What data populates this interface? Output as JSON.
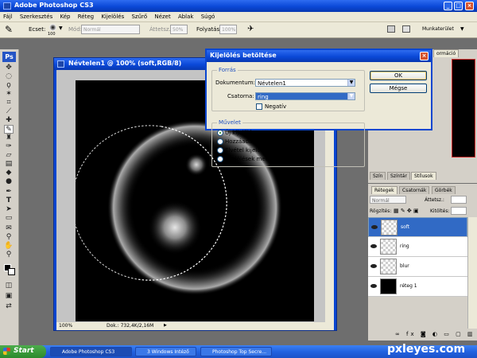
{
  "app": {
    "title": "Adobe Photoshop CS3"
  },
  "menu": [
    "Fájl",
    "Szerkesztés",
    "Kép",
    "Réteg",
    "Kijelölés",
    "Szűrő",
    "Nézet",
    "Ablak",
    "Súgó"
  ],
  "options": {
    "brush_label": "Ecset:",
    "brush_size": "100",
    "mode_label": "Mód:",
    "mode_value": "Normál",
    "opacity_label": "Áttetsz.:",
    "opacity_value": "50%",
    "flow_label": "Folyatás:",
    "flow_value": "100%",
    "workspace_label": "Munkaterület"
  },
  "document": {
    "title": "Névtelen1 @ 100% (soft,RGB/8)",
    "zoom": "100%",
    "doc_info": "Dok.: 732,4K/2,16M"
  },
  "dialog": {
    "title": "Kijelölés betöltése",
    "source_group": "Forrás",
    "document_label": "Dokumentum:",
    "document_value": "Névtelen1",
    "channel_label": "Csatorna:",
    "channel_value": "ring",
    "invert_label": "Negatív",
    "operation_group": "Művelet",
    "operations": [
      {
        "label": "Új kijelölés",
        "selected": true
      },
      {
        "label": "Hozzáadás kijelöléshez",
        "selected": false
      },
      {
        "label": "Elvétel kijelölésből",
        "selected": false
      },
      {
        "label": "Kijelölések metszete",
        "selected": false
      }
    ],
    "ok_label": "OK",
    "cancel_label": "Mégse"
  },
  "nav_panel": {
    "tab_fragment": "ormáció"
  },
  "history_tabs": [
    "Szín",
    "Színtár",
    "Stílusok"
  ],
  "layers_panel": {
    "tabs": [
      "Rétegek",
      "Csatornák",
      "Görbék"
    ],
    "blend_mode": "Normál",
    "opacity_label": "Áttetsz.:",
    "lock_label": "Rögzítés:",
    "fill_label": "Kitöltés:",
    "layers": [
      {
        "name": "soft",
        "selected": true
      },
      {
        "name": "ring",
        "selected": false
      },
      {
        "name": "blur",
        "selected": false
      },
      {
        "name": "réteg 1",
        "selected": false
      }
    ]
  },
  "taskbar": {
    "start_label": "Start",
    "tasks": [
      "Adobe Photoshop CS3",
      "3 Windows Intéző",
      "Photoshop Top Secre..."
    ]
  },
  "watermark": "pxleyes.com"
}
